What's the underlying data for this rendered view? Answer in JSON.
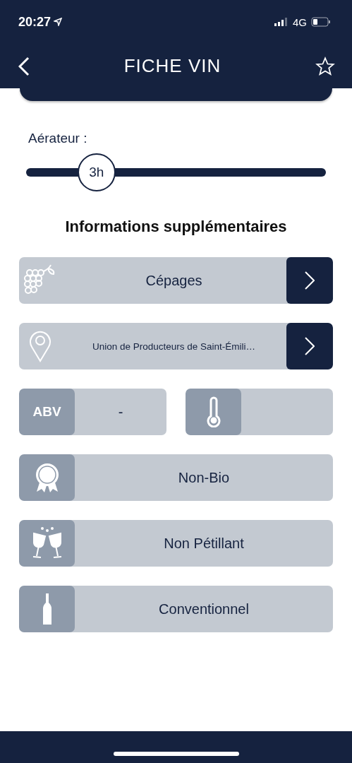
{
  "status_bar": {
    "time": "20:27",
    "network": "4G"
  },
  "header": {
    "title": "FICHE VIN",
    "favorite": false
  },
  "aerator": {
    "label": "Aérateur :",
    "value": "3h",
    "level": 0.235
  },
  "section_title": "Informations supplémentaires",
  "rows": [
    {
      "kind": "grapes",
      "text": "Cépages"
    },
    {
      "kind": "origin",
      "text": "Union de Producteurs de Saint-Émili…"
    },
    {
      "kind": "specs",
      "abv_label": "ABV",
      "abv_value": "-"
    },
    {
      "kind": "organic",
      "text": "Non-Bio"
    },
    {
      "kind": "sparkling",
      "text": "Non Pétillant"
    },
    {
      "kind": "bottle",
      "text": "Conventionnel"
    }
  ]
}
